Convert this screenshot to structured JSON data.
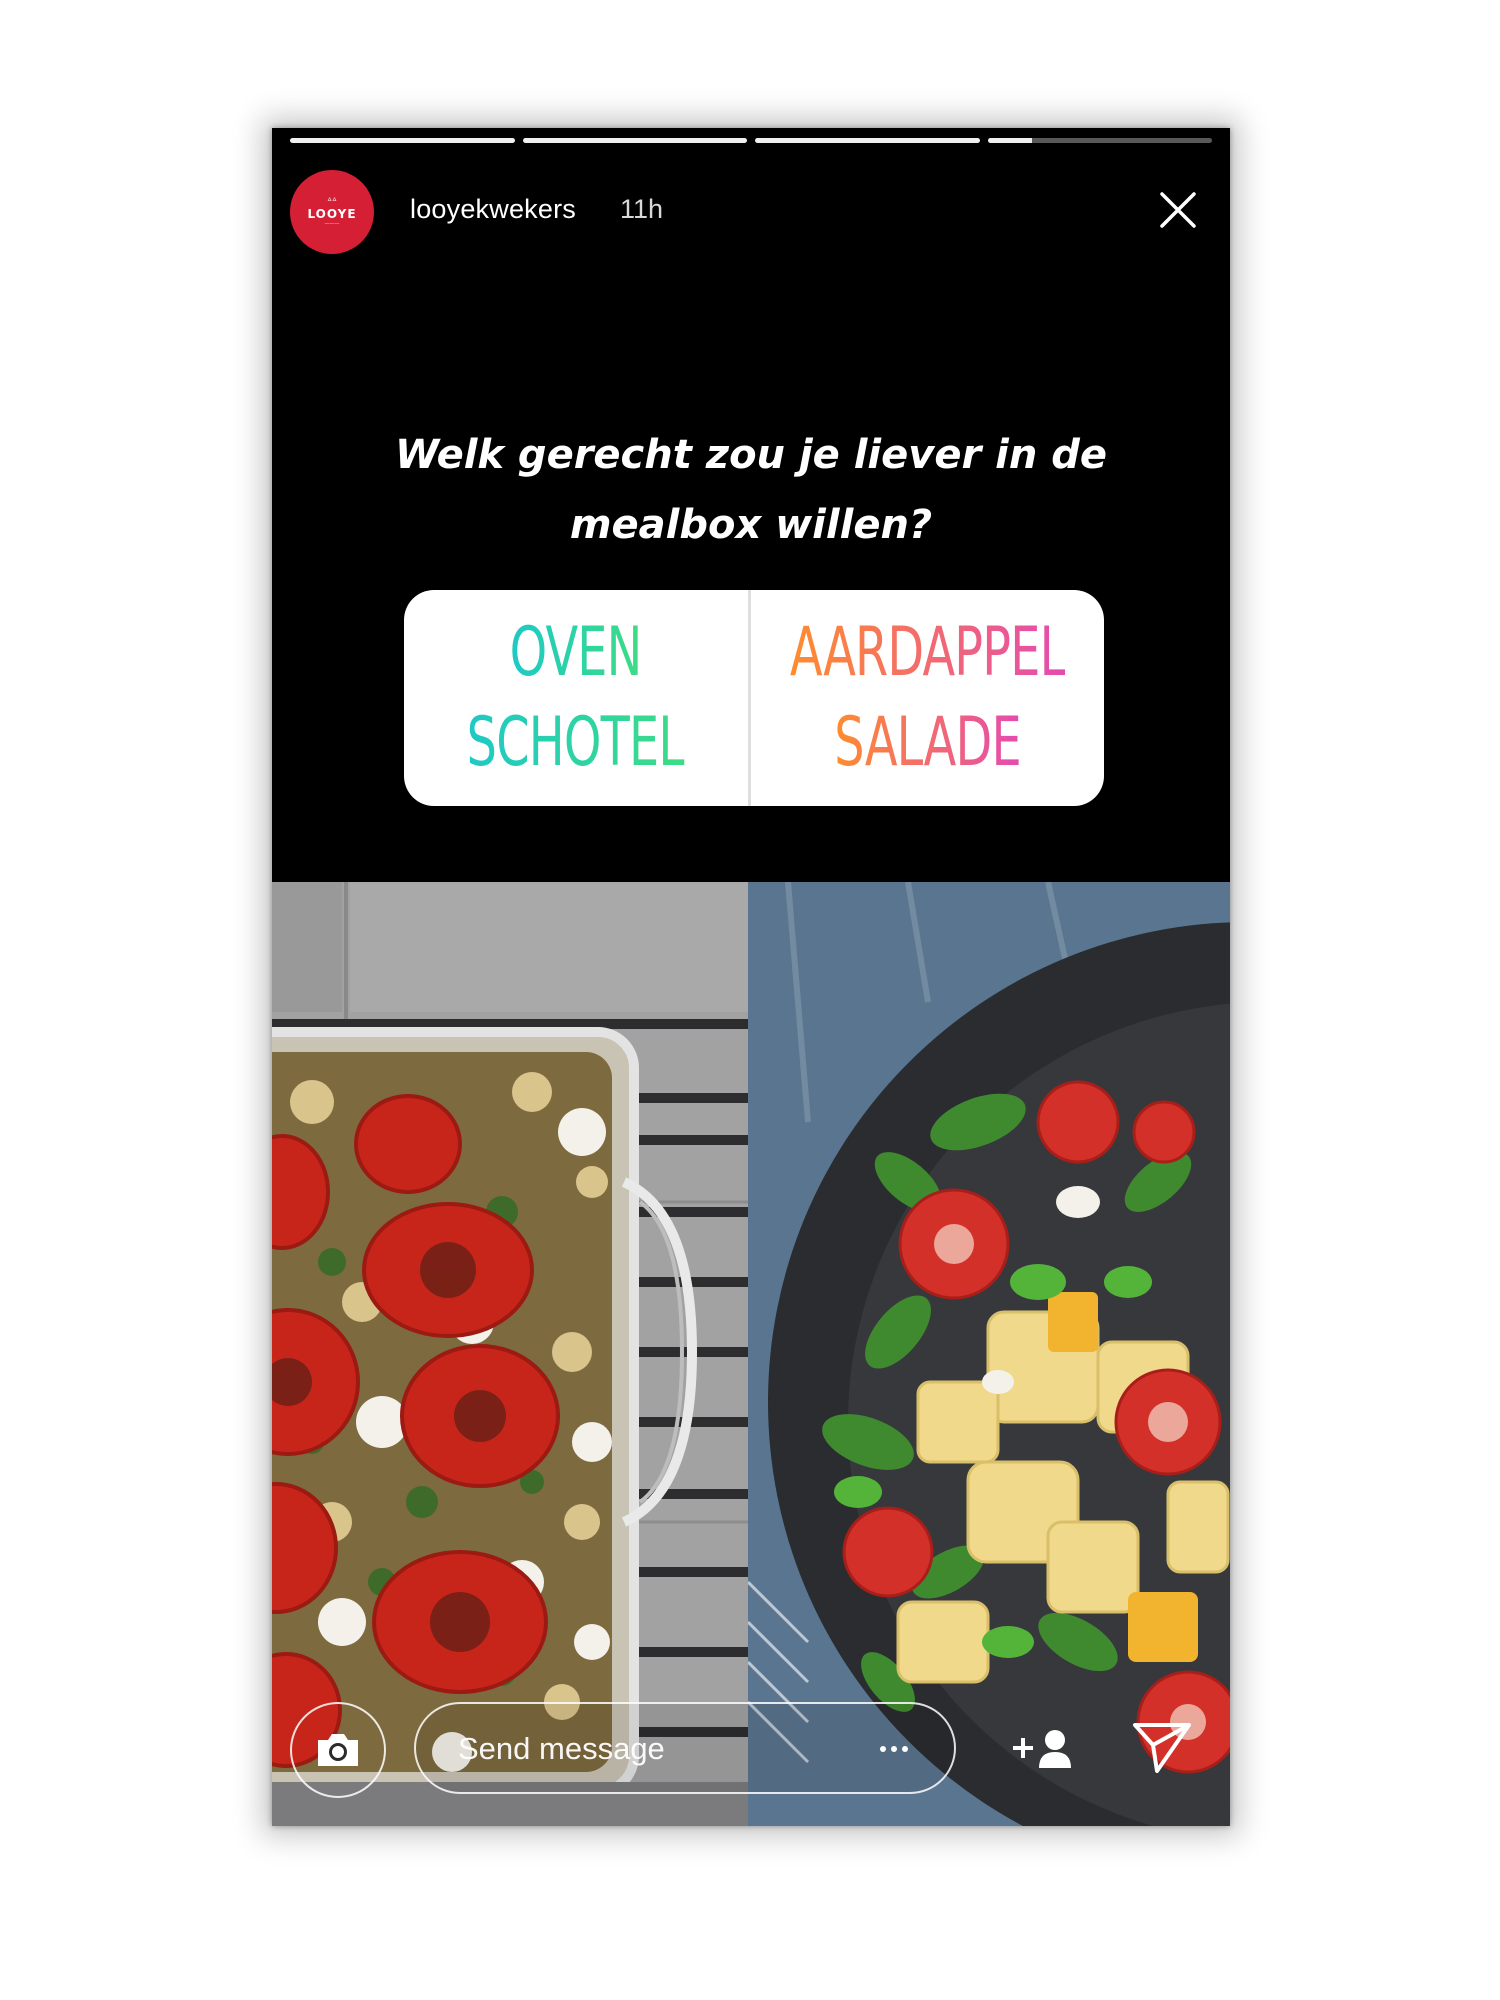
{
  "story": {
    "progress": [
      1,
      1,
      1,
      0.2
    ],
    "account": {
      "username": "looyekwekers",
      "time_ago": "11h",
      "avatar_logo_text": "LOOYE",
      "avatar_color": "#d51f35"
    }
  },
  "poll": {
    "question": "Welk gerecht zou je liever in de mealbox willen?",
    "options": [
      {
        "lines": [
          "OVEN",
          "SCHOTEL"
        ],
        "gradient": [
          "#1ec9c6",
          "#3ddc84"
        ]
      },
      {
        "lines": [
          "AARDAPPEL",
          "SALADE"
        ],
        "gradient": [
          "#ff8c2e",
          "#e44bb0"
        ]
      }
    ]
  },
  "photos": [
    {
      "name": "ovenschotel-photo"
    },
    {
      "name": "aardappelsalade-photo"
    }
  ],
  "composer": {
    "placeholder": "Send message"
  },
  "icons": {
    "close": "close-icon",
    "camera": "camera-icon",
    "more": "more-icon",
    "add_friend": "add-friend-icon",
    "send": "send-icon"
  }
}
